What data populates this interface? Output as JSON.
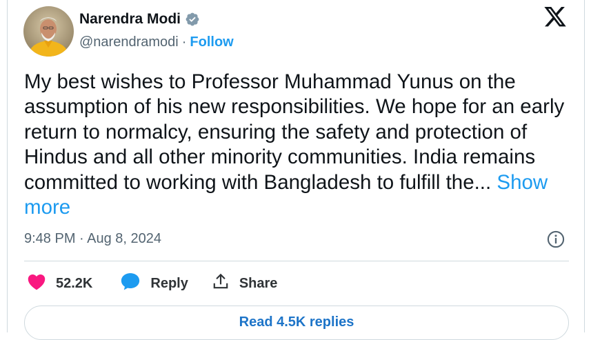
{
  "author": {
    "name": "Narendra Modi",
    "handle": "@narendramodi",
    "separator": "·",
    "follow_label": "Follow",
    "verified": true
  },
  "tweet": {
    "text": "My best wishes to Professor Muhammad Yunus on the assumption of his new responsibilities. We hope for an early return to normalcy, ensuring the safety and protection of Hindus and all other minority communities. India remains committed to working with Bangladesh to fulfill the...",
    "show_more_label": "Show more",
    "timestamp": "9:48 PM · Aug 8, 2024"
  },
  "actions": {
    "likes": "52.2K",
    "reply_label": "Reply",
    "share_label": "Share"
  },
  "read_replies_label": "Read 4.5K replies",
  "icons": {
    "logo": "x-logo-icon",
    "verified": "verified-badge-icon",
    "info": "info-icon",
    "like": "heart-icon",
    "reply": "speech-bubble-icon",
    "share": "share-upload-icon"
  },
  "colors": {
    "accent": "#1d9bf0",
    "like": "#f91880",
    "muted": "#536471",
    "text": "#0f1419",
    "verified": "#829aab"
  }
}
